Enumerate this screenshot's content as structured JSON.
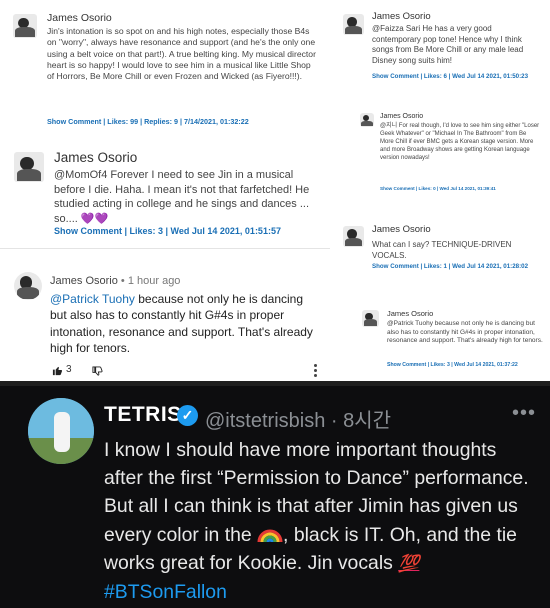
{
  "comments": [
    {
      "id": "c1",
      "author": "James Osorio",
      "text": "Jin's intonation is so spot on and his high notes, especially those B4s on \"worry\", always have resonance and support (and he's the only one using a belt voice on that part!). A true belting king. My musical director heart is so happy! I would love to see him in a musical like Little Shop of Horrors, Be More Chill or even Frozen and Wicked (as Fiyero!!!).",
      "meta": "Show Comment | Likes: 99 | Replies: 9 | 7/14/2021, 01:32:22"
    },
    {
      "id": "c2",
      "author": "James Osorio",
      "text": "@MomOf4 Forever I need to see Jin in a musical before I die. Haha. I mean it's not that farfetched! He studied acting in college and he sings and dances ... so.... 💜💜",
      "meta": "Show Comment | Likes: 3 | Wed Jul 14 2021, 01:51:57"
    },
    {
      "id": "c3",
      "author": "James Osorio",
      "time": "• 1 hour ago",
      "mention": "@Patrick Tuohy",
      "text": " because not only he is dancing but also has to constantly hit G#4s in proper intonation, resonance and support. That's already high for tenors.",
      "likes": "3"
    },
    {
      "id": "c4",
      "author": "James Osorio",
      "text": "@Faizza Sari He has a very good contemporary pop tone! Hence why I think songs from Be More Chill or any male lead Disney song suits him!",
      "meta": "Show Comment | Likes: 6 | Wed Jul 14 2021, 01:50:23"
    },
    {
      "id": "c5",
      "author": "James Osorio",
      "text": "@지니 For real though, I'd love to see him sing either \"Loser Geek Whatever\" or \"Michael In The Bathroom\" from Be More Chill if ever BMC gets a Korean stage version. More and more Broadway shows are getting Korean language version nowadays!",
      "meta": "Show Comment | Likes: 0 | Wed Jul 14 2021, 01:39:41"
    },
    {
      "id": "c6",
      "author": "James Osorio",
      "text": "What can I say? TECHNIQUE-DRIVEN VOCALS.",
      "meta": "Show Comment | Likes: 1 | Wed Jul 14 2021, 01:28:02"
    },
    {
      "id": "c7",
      "author": "James Osorio",
      "text": "@Patrick Tuohy because not only he is dancing but also has to constantly hit G#4s in proper intonation, resonance and support. That's already high for tenors.",
      "meta": "Show Comment | Likes: 3 | Wed Jul 14 2021, 01:37:22"
    }
  ],
  "tweet": {
    "name": "TETRIS",
    "handle": "@itstetrisbish · 8시간",
    "more": "•••",
    "text_part1": "I know I should have more important thoughts after the first “Permission to Dance” performance. But all I can think is that after Jimin has given us every color in the ",
    "text_part2": ", black is IT. Oh, and the tie works great for Kookie. Jin vocals ",
    "hundred": "💯",
    "hashtag": "#BTSonFallon"
  },
  "icons": {
    "thumbs_up": "thumbs-up-icon",
    "thumbs_down": "thumbs-down-icon",
    "more": "vertical-dots-icon",
    "verified": "verified-badge-icon",
    "rainbow": "rainbow-emoji"
  },
  "colors": {
    "link": "#1a6fb5",
    "tweet_bg": "#0d0d0f",
    "twitter_blue": "#1d9bf0"
  }
}
